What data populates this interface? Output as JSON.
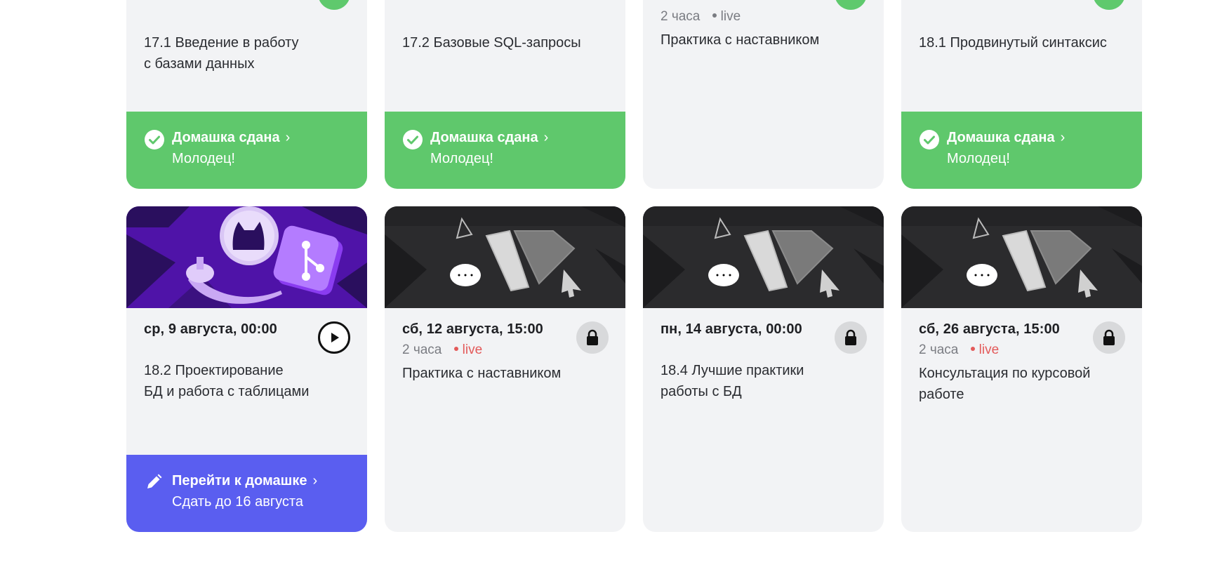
{
  "cards_row1": [
    {
      "title_line1": "17.1 Введение в работу",
      "title_line2": "с базами данных",
      "footer": {
        "status": "Домашка сдана",
        "note": "Молодец!"
      }
    },
    {
      "title_line1": "17.2 Базовые SQL-запросы",
      "title_line2": "",
      "footer": {
        "status": "Домашка сдана",
        "note": "Молодец!"
      }
    },
    {
      "duration": "2 часа",
      "live": "live",
      "title_line1": "Практика с наставником",
      "title_line2": ""
    },
    {
      "title_line1": "18.1 Продвинутый синтаксис",
      "title_line2": "",
      "footer": {
        "status": "Домашка сдана",
        "note": "Молодец!"
      }
    }
  ],
  "cards_row2": [
    {
      "date": "ср, 9 августа, 00:00",
      "title_line1": "18.2 Проектирование",
      "title_line2": "БД и работа с таблицами",
      "action_icon": "play-icon",
      "footer": {
        "status": "Перейти к домашке",
        "note": "Сдать до 16 августа"
      }
    },
    {
      "date": "сб, 12 августа, 15:00",
      "duration": "2 часа",
      "live": "live",
      "title_line1": "Практика с наставником",
      "title_line2": "",
      "action_icon": "lock-icon"
    },
    {
      "date": "пн, 14 августа, 00:00",
      "title_line1": "18.4 Лучшие практики",
      "title_line2": "работы с БД",
      "action_icon": "lock-icon"
    },
    {
      "date": "сб, 26 августа, 15:00",
      "duration": "2 часа",
      "live": "live",
      "title_line1": "Консультация по курсовой",
      "title_line2": "работе",
      "action_icon": "lock-icon"
    }
  ],
  "colors": {
    "done_green": "#5fc86c",
    "homework_blue": "#5a5ef0",
    "live_red": "#e35a5a",
    "card_bg": "#f2f3f5"
  }
}
